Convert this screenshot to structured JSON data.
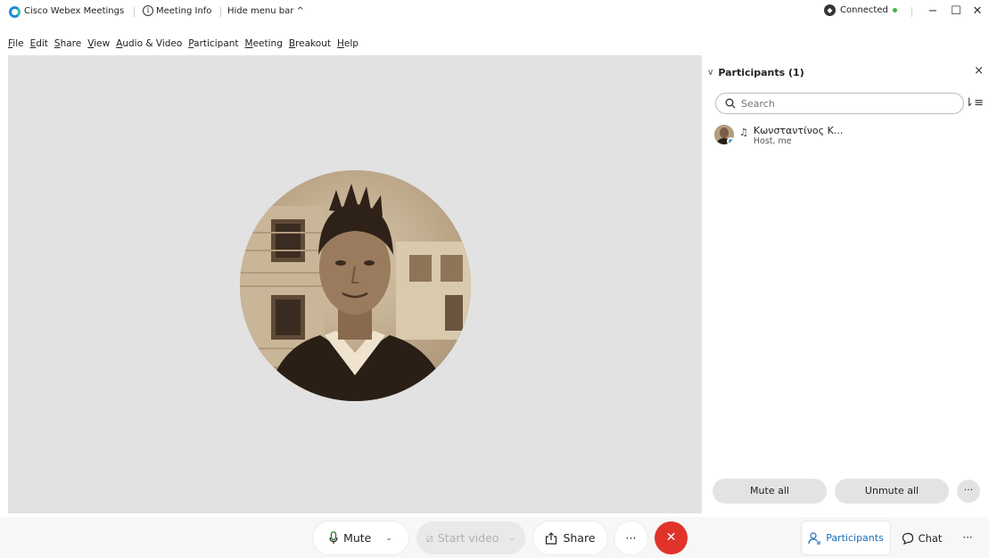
{
  "titlebar": {
    "app_title": "Cisco Webex Meetings",
    "meeting_info": "Meeting Info",
    "hide_menu": "Hide menu bar ^",
    "connection_status": "Connected"
  },
  "menu": [
    "File",
    "Edit",
    "Share",
    "View",
    "Audio & Video",
    "Participant",
    "Meeting",
    "Breakout",
    "Help"
  ],
  "menu_accel": [
    "F",
    "E",
    "S",
    "V",
    "A",
    "P",
    "M",
    "B",
    "H"
  ],
  "panel": {
    "title": "Participants (1)",
    "search_placeholder": "Search",
    "participants": [
      {
        "name": "Κωνσταντίνος Κ...",
        "role": "Host, me"
      }
    ],
    "mute_all": "Mute all",
    "unmute_all": "Unmute all"
  },
  "toolbar": {
    "mute": "Mute",
    "start_video": "Start video",
    "share": "Share",
    "participants_tab": "Participants",
    "chat_tab": "Chat"
  },
  "colors": {
    "accent": "#1a6fbf",
    "end_call": "#e0342a",
    "connected_dot": "#3bb54a",
    "stage_bg": "#e2e2e2"
  }
}
